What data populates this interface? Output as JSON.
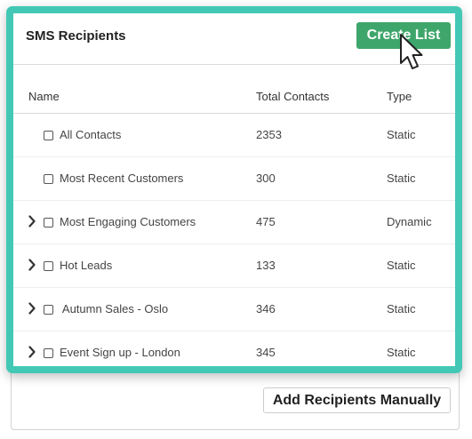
{
  "header": {
    "title": "SMS Recipients",
    "create_label": "Create List"
  },
  "columns": {
    "name": "Name",
    "total": "Total Contacts",
    "type": "Type"
  },
  "rows": [
    {
      "name": "All Contacts",
      "total": "2353",
      "type": "Static",
      "expandable": false
    },
    {
      "name": "Most Recent Customers",
      "total": "300",
      "type": "Static",
      "expandable": false
    },
    {
      "name": "Most Engaging Customers",
      "total": "475",
      "type": "Dynamic",
      "expandable": true
    },
    {
      "name": "Hot Leads",
      "total": "133",
      "type": "Static",
      "expandable": true
    },
    {
      "name": " Autumn Sales - Oslo",
      "total": "346",
      "type": "Static",
      "expandable": true
    },
    {
      "name": "Event Sign up - London",
      "total": "345",
      "type": "Static",
      "expandable": true
    }
  ],
  "footer": {
    "manual_label": "Add Recipients Manually"
  },
  "colors": {
    "highlight": "#44c8b6",
    "primary_button": "#3fa66b"
  },
  "icons": {
    "expand": "chevron-right-icon",
    "pointer": "mouse-pointer-icon"
  }
}
